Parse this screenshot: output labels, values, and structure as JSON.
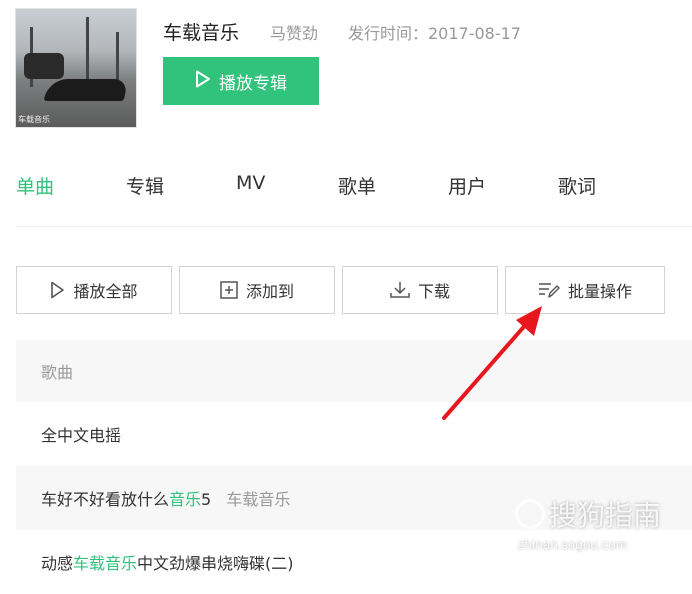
{
  "album": {
    "cover_caption": "车载音乐",
    "title": "车载音乐",
    "artist": "马赞劲",
    "release_label": "发行时间：2017-08-17",
    "play_button": "播放专辑"
  },
  "tabs": [
    {
      "label": "单曲",
      "active": true
    },
    {
      "label": "专辑"
    },
    {
      "label": "MV"
    },
    {
      "label": "歌单"
    },
    {
      "label": "用户"
    },
    {
      "label": "歌词"
    }
  ],
  "toolbar": {
    "play_all": "播放全部",
    "add_to": "添加到",
    "download": "下载",
    "batch": "批量操作"
  },
  "table": {
    "column_header": "歌曲",
    "rows": [
      {
        "parts": [
          "全中文电摇"
        ]
      },
      {
        "parts": [
          "车好不好看放什么",
          "音乐",
          "5",
          "车载音乐"
        ]
      },
      {
        "parts": [
          "动感",
          "车载音乐",
          "中文劲爆串烧嗨碟(二)"
        ]
      }
    ]
  },
  "watermark": {
    "logo_text": "搜狗指南",
    "url": "zhinan.sogou.com"
  },
  "colors": {
    "accent": "#31c27c",
    "arrow": "#e8171d"
  }
}
